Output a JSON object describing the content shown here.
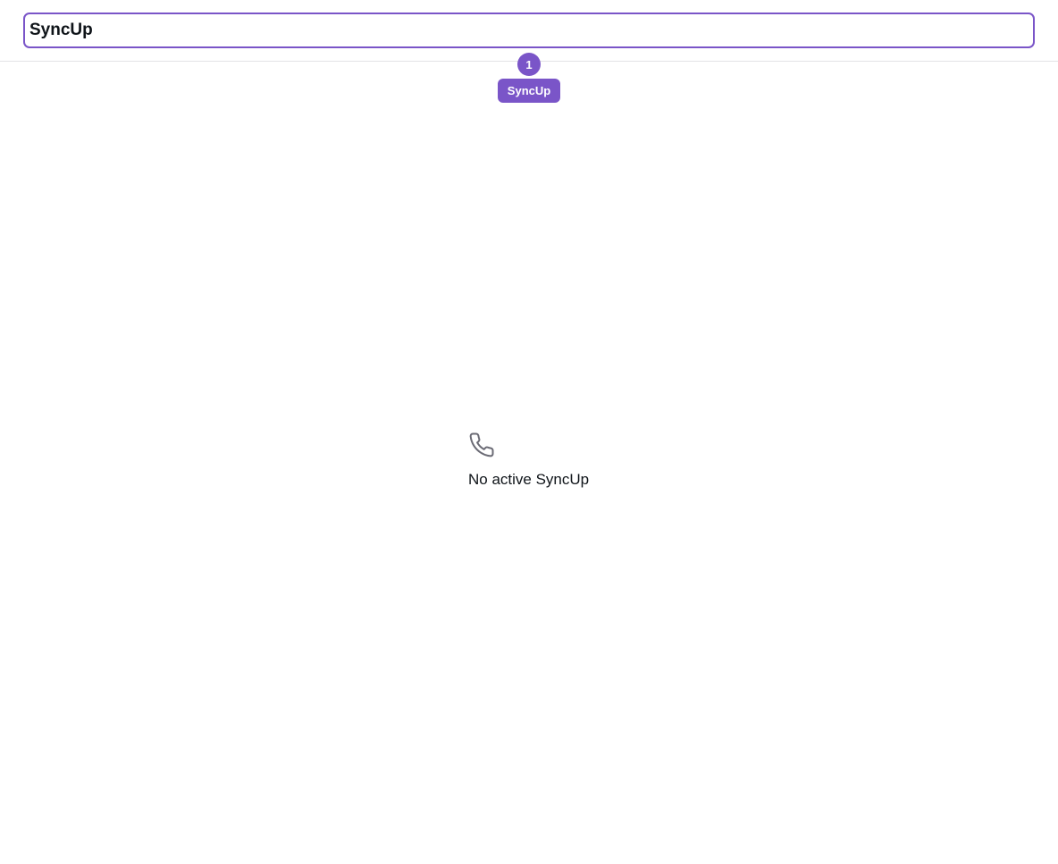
{
  "header": {
    "title_value": "SyncUp"
  },
  "step": {
    "number": "1",
    "label": "SyncUp"
  },
  "empty_state": {
    "icon": "phone-icon",
    "message": "No active SyncUp"
  },
  "colors": {
    "accent": "#7a55c8",
    "text": "#0f1419",
    "icon": "#6b6b75",
    "divider": "#e2e2e6"
  }
}
